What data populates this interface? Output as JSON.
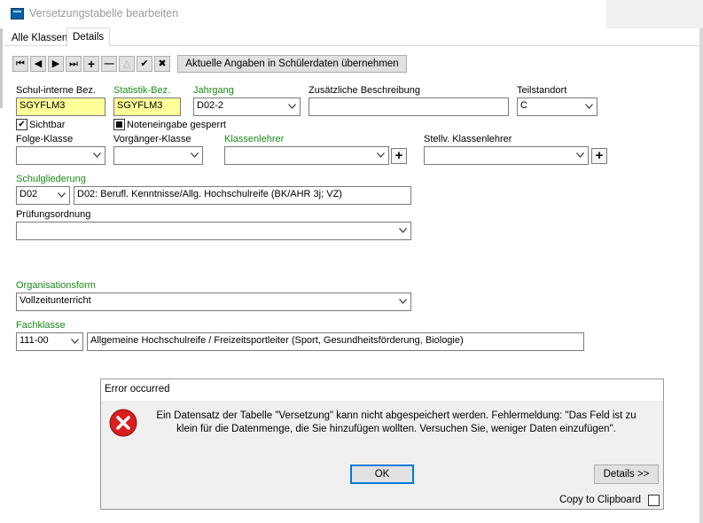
{
  "window": {
    "title": "Versetzungstabelle bearbeiten"
  },
  "tabs": [
    {
      "label": "Alle Klassen"
    },
    {
      "label": "Details"
    }
  ],
  "toolbar": {
    "first": "⏮",
    "prev": "◀",
    "next": "▶",
    "last": "⏭",
    "add": "+",
    "remove": "—",
    "edit": "△",
    "confirm": "✔",
    "cancel": "✖",
    "apply_label": "Aktuelle Angaben in Schülerdaten übernehmen"
  },
  "form": {
    "schul_interne_bez": {
      "label": "Schul-interne Bez.",
      "value": "SGYFLM3"
    },
    "statistik_bez": {
      "label": "Statistik-Bez.",
      "value": "SGYFLM3"
    },
    "jahrgang": {
      "label": "Jahrgang",
      "value": "D02-2"
    },
    "zusaetzliche_beschreibung": {
      "label": "Zusätzliche Beschreibung",
      "value": ""
    },
    "teilstandort": {
      "label": "Teilstandort",
      "value": "C"
    },
    "sichtbar": {
      "label": "Sichtbar",
      "checked": true
    },
    "noteneingabe_gesperrt": {
      "label": "Noteneingabe gesperrt",
      "checked": "indeterminate"
    },
    "folge_klasse": {
      "label": "Folge-Klasse",
      "value": ""
    },
    "vorgaenger_klasse": {
      "label": "Vorgänger-Klasse",
      "value": ""
    },
    "klassenlehrer": {
      "label": "Klassenlehrer",
      "value": ""
    },
    "stellv_klassenlehrer": {
      "label": "Stellv. Klassenlehrer",
      "value": ""
    },
    "schulgliederung": {
      "label": "Schulgliederung",
      "code": "D02",
      "description": "D02: Berufl. Kenntnisse/Allg. Hochschulreife (BK/AHR 3j; VZ)"
    },
    "pruefungsordnung": {
      "label": "Prüfungsordnung",
      "value": ""
    },
    "organisationsform": {
      "label": "Organisationsform",
      "value": "Vollzeitunterricht"
    },
    "fachklasse": {
      "label": "Fachklasse",
      "code": "111-00",
      "description": "Allgemeine Hochschulreife / Freizeitsportleiter (Sport, Gesundheitsförderung, Biologie)"
    }
  },
  "dialog": {
    "title": "Error occurred",
    "message_line1": "Ein Datensatz der Tabelle \"Versetzung\" kann nicht abgespeichert werden. Fehlermeldung: \"Das Feld ist zu",
    "message_line2": "klein für die Datenmenge, die Sie hinzufügen wollten. Versuchen Sie, weniger Daten einzufügen\".",
    "ok_label": "OK",
    "details_label": "Details >>",
    "clipboard_label": "Copy to Clipboard"
  },
  "colors": {
    "required_label": "#1a8a1a",
    "required_field": "#ffff99",
    "error_icon": "#d81e1e",
    "ok_focus": "#0078d7"
  }
}
